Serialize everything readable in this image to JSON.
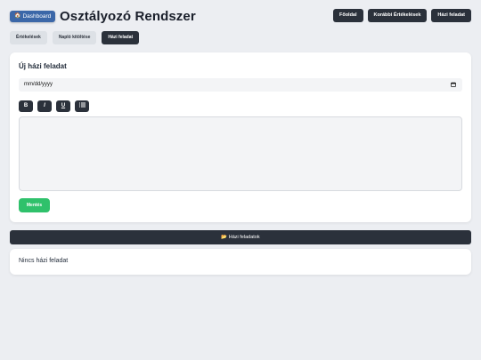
{
  "header": {
    "dashboard_label": "Dashboard",
    "dashboard_icon": "home-icon",
    "title": "Osztályozó Rendszer",
    "nav": [
      {
        "label": "Főoldal"
      },
      {
        "label": "Korábbi Értékelések"
      },
      {
        "label": "Házi feladat"
      }
    ]
  },
  "tabs": [
    {
      "label": "Értékelések",
      "active": false
    },
    {
      "label": "Napló kitöltése",
      "active": false
    },
    {
      "label": "Házi feladat",
      "active": true
    }
  ],
  "form": {
    "title": "Új házi feladat",
    "date_value": "mm/dd/yyyy",
    "toolbar": {
      "bold": "B",
      "italic": "I",
      "underline": "U",
      "list_icon": "list-icon"
    },
    "save_label": "Mentés"
  },
  "homework_section": {
    "bar_label": "📂 Házi feladatok",
    "empty_text": "Nincs házi feladat"
  },
  "colors": {
    "accent_blue": "#3b67a8",
    "dark": "#2b313b",
    "success": "#2fc16b",
    "background": "#eceef2"
  }
}
